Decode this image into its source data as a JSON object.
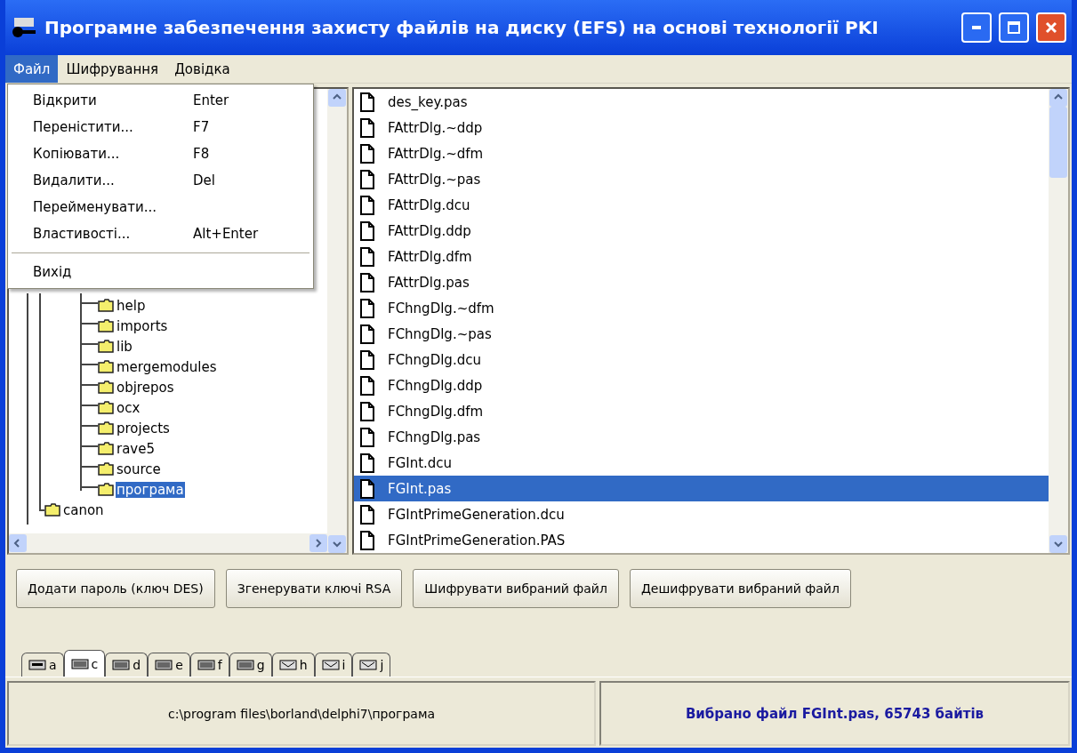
{
  "window": {
    "title": "Програмне забезпечення захисту файлів на диску (EFS) на основі технології PKI"
  },
  "menu": [
    {
      "label": "Файл",
      "selected": true
    },
    {
      "label": "Шифрування",
      "selected": false
    },
    {
      "label": "Довідка",
      "selected": false
    }
  ],
  "dropdown": [
    {
      "kind": "item",
      "label": "Відкрити",
      "shortcut": "Enter"
    },
    {
      "kind": "item",
      "label": "Переністити...",
      "shortcut": "F7"
    },
    {
      "kind": "item",
      "label": "Копіювати...",
      "shortcut": "F8"
    },
    {
      "kind": "item",
      "label": "Видалити...",
      "shortcut": "Del"
    },
    {
      "kind": "item",
      "label": "Перейменувати..."
    },
    {
      "kind": "item",
      "label": "Властивості...",
      "shortcut": "Alt+Enter"
    },
    {
      "kind": "separator"
    },
    {
      "kind": "item",
      "label": "Вихід"
    }
  ],
  "tree": [
    {
      "children": [
        {
          "label": "help",
          "selected": false
        },
        {
          "label": "imports",
          "selected": false
        },
        {
          "label": "lib",
          "selected": false
        },
        {
          "label": "mergemodules",
          "selected": false
        },
        {
          "label": "objrepos",
          "selected": false
        },
        {
          "label": "ocx",
          "selected": false
        },
        {
          "label": "projects",
          "selected": false
        },
        {
          "label": "rave5",
          "selected": false
        },
        {
          "label": "source",
          "selected": false
        },
        {
          "label": "програма",
          "selected": true
        }
      ]
    },
    {
      "label": "canon",
      "selected": false
    }
  ],
  "files": [
    {
      "name": "des_key.pas",
      "selected": false
    },
    {
      "name": "FAttrDlg.~ddp",
      "selected": false
    },
    {
      "name": "FAttrDlg.~dfm",
      "selected": false
    },
    {
      "name": "FAttrDlg.~pas",
      "selected": false
    },
    {
      "name": "FAttrDlg.dcu",
      "selected": false
    },
    {
      "name": "FAttrDlg.ddp",
      "selected": false
    },
    {
      "name": "FAttrDlg.dfm",
      "selected": false
    },
    {
      "name": "FAttrDlg.pas",
      "selected": false
    },
    {
      "name": "FChngDlg.~dfm",
      "selected": false
    },
    {
      "name": "FChngDlg.~pas",
      "selected": false
    },
    {
      "name": "FChngDlg.dcu",
      "selected": false
    },
    {
      "name": "FChngDlg.ddp",
      "selected": false
    },
    {
      "name": "FChngDlg.dfm",
      "selected": false
    },
    {
      "name": "FChngDlg.pas",
      "selected": false
    },
    {
      "name": "FGInt.dcu",
      "selected": false
    },
    {
      "name": "FGInt.pas",
      "selected": true
    },
    {
      "name": "FGIntPrimeGeneration.dcu",
      "selected": false
    },
    {
      "name": "FGIntPrimeGeneration.PAS",
      "selected": false
    }
  ],
  "buttons": [
    "Додати пароль (ключ DES)",
    "Згенерувати ключі RSA",
    "Шифрувати вибраний файл",
    "Дешифрувати вибраний файл"
  ],
  "drives": [
    {
      "label": "a",
      "kind": "floppy",
      "selected": false
    },
    {
      "label": "c",
      "kind": "disk",
      "selected": true
    },
    {
      "label": "d",
      "kind": "disk",
      "selected": false
    },
    {
      "label": "e",
      "kind": "disk",
      "selected": false
    },
    {
      "label": "f",
      "kind": "disk",
      "selected": false
    },
    {
      "label": "g",
      "kind": "disk",
      "selected": false
    },
    {
      "label": "h",
      "kind": "network",
      "selected": false
    },
    {
      "label": "i",
      "kind": "network",
      "selected": false
    },
    {
      "label": "j",
      "kind": "network",
      "selected": false
    }
  ],
  "status_bar": {
    "path": "c:\\program files\\borland\\delphi7\\програма",
    "info": "Вибрано файл FGInt.pas, 65743 байтів"
  }
}
